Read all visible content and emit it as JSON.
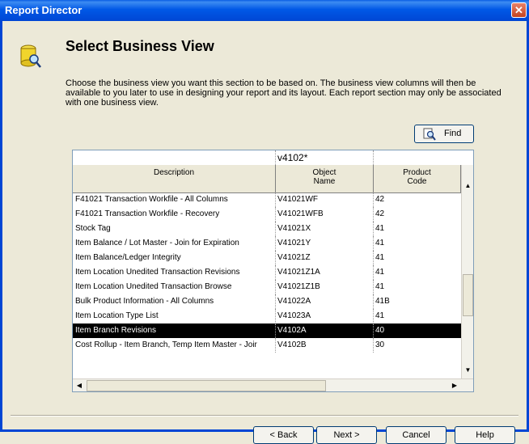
{
  "window": {
    "title": "Report Director",
    "close_glyph": "✕"
  },
  "header": {
    "title": "Select Business View",
    "icon": "database-search-icon"
  },
  "description": "Choose the business view you want this section to be based on.  The business view columns will then be available to you later to use in designing your report and its layout.  Each report section may only be associated with one business view.",
  "find_button": {
    "label": "Find",
    "icon": "find-magnifier-icon"
  },
  "grid": {
    "qbe": {
      "description": "",
      "object_name": "v4102*",
      "product_code": ""
    },
    "columns": {
      "description": "Description",
      "object_name": "Object\nName",
      "product_code": "Product\nCode"
    },
    "rows": [
      {
        "description": "F41021 Transaction Workfile - All Columns",
        "object_name": "V41021WF",
        "product_code": "42"
      },
      {
        "description": "F41021 Transaction Workfile - Recovery",
        "object_name": "V41021WFB",
        "product_code": "42"
      },
      {
        "description": "Stock Tag",
        "object_name": "V41021X",
        "product_code": "41"
      },
      {
        "description": "Item Balance / Lot Master - Join for Expiration",
        "object_name": "V41021Y",
        "product_code": "41"
      },
      {
        "description": "Item Balance/Ledger Integrity",
        "object_name": "V41021Z",
        "product_code": "41"
      },
      {
        "description": "Item Location Unedited Transaction Revisions",
        "object_name": "V41021Z1A",
        "product_code": "41"
      },
      {
        "description": "Item Location Unedited Transaction Browse",
        "object_name": "V41021Z1B",
        "product_code": "41"
      },
      {
        "description": "Bulk Product Information - All Columns",
        "object_name": "V41022A",
        "product_code": "41B"
      },
      {
        "description": "Item Location Type List",
        "object_name": "V41023A",
        "product_code": "41"
      },
      {
        "description": "Item Branch Revisions",
        "object_name": "V4102A",
        "product_code": "40",
        "selected": true
      },
      {
        "description": "Cost Rollup - Item Branch, Temp Item Master - Joir",
        "object_name": "V4102B",
        "product_code": "30"
      }
    ]
  },
  "buttons": {
    "back": "< Back",
    "next": "Next >",
    "cancel": "Cancel",
    "help": "Help"
  }
}
